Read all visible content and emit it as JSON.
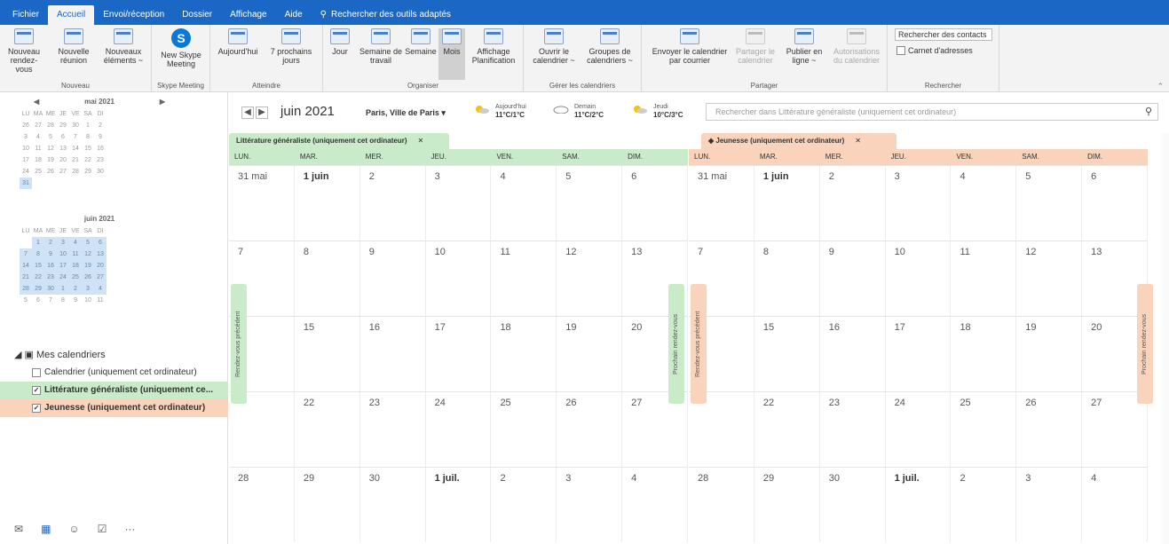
{
  "tabs": [
    "Fichier",
    "Accueil",
    "Envoi/réception",
    "Dossier",
    "Affichage",
    "Aide",
    "Rechercher des outils adaptés"
  ],
  "active_tab": "Accueil",
  "ribbon": {
    "nouveau": {
      "label": "Nouveau",
      "btn1": "Nouveau rendez-vous",
      "btn2": "Nouvelle réunion",
      "btn3": "Nouveaux éléments ~"
    },
    "skype": {
      "label": "Skype Meeting",
      "btn": "New Skype Meeting"
    },
    "atteindre": {
      "label": "Atteindre",
      "btn1": "Aujourd'hui",
      "btn2": "7 prochains jours"
    },
    "organiser": {
      "label": "Organiser",
      "jour": "Jour",
      "semaine_travail": "Semaine de travail",
      "semaine": "Semaine",
      "mois": "Mois",
      "planif": "Affichage Planification"
    },
    "gerer": {
      "label": "Gérer les calendriers",
      "btn1": "Ouvrir le calendrier ~",
      "btn2": "Groupes de calendriers ~"
    },
    "partager": {
      "label": "Partager",
      "btn1": "Envoyer le calendrier par courrier",
      "btn2": "Partager le calendrier",
      "btn3": "Publier en ligne ~",
      "btn4": "Autorisations du calendrier"
    },
    "rechercher": {
      "label": "Rechercher",
      "search_contacts": "Rechercher des contacts",
      "carnet": "Carnet d'adresses"
    }
  },
  "mini_may": {
    "title": "mai 2021",
    "days": [
      "LU",
      "MA",
      "ME",
      "JE",
      "VE",
      "SA",
      "DI"
    ],
    "rows": [
      [
        "26",
        "27",
        "28",
        "29",
        "30",
        "1",
        "2"
      ],
      [
        "3",
        "4",
        "5",
        "6",
        "7",
        "8",
        "9"
      ],
      [
        "10",
        "11",
        "12",
        "13",
        "14",
        "15",
        "16"
      ],
      [
        "17",
        "18",
        "19",
        "20",
        "21",
        "22",
        "23"
      ],
      [
        "24",
        "25",
        "26",
        "27",
        "28",
        "29",
        "30"
      ],
      [
        "31",
        "",
        "",
        "",
        "",
        "",
        ""
      ]
    ]
  },
  "mini_june": {
    "title": "juin 2021",
    "days": [
      "LU",
      "MA",
      "ME",
      "JE",
      "VE",
      "SA",
      "DI"
    ],
    "rows": [
      [
        "",
        "1",
        "2",
        "3",
        "4",
        "5",
        "6"
      ],
      [
        "7",
        "8",
        "9",
        "10",
        "11",
        "12",
        "13"
      ],
      [
        "14",
        "15",
        "16",
        "17",
        "18",
        "19",
        "20"
      ],
      [
        "21",
        "22",
        "23",
        "24",
        "25",
        "26",
        "27"
      ],
      [
        "28",
        "29",
        "30",
        "1",
        "2",
        "3",
        "4"
      ],
      [
        "5",
        "6",
        "7",
        "8",
        "9",
        "10",
        "11"
      ]
    ]
  },
  "calendars": {
    "header": "Mes calendriers",
    "items": [
      "Calendrier (uniquement cet ordinateur)",
      "Littérature généraliste (uniquement ce...",
      "Jeunesse (uniquement cet ordinateur)"
    ]
  },
  "bottom_nav": [
    "mail-icon",
    "calendar-icon",
    "people-icon",
    "tasks-icon",
    "more-icon"
  ],
  "header": {
    "month": "juin 2021",
    "location": "Paris, Ville de Paris",
    "weather": [
      {
        "day": "Aujourd'hui",
        "temp": "11°C/1°C"
      },
      {
        "day": "Demain",
        "temp": "11°C/2°C"
      },
      {
        "day": "Jeudi",
        "temp": "10°C/3°C"
      }
    ],
    "search_placeholder": "Rechercher dans Littérature généraliste (uniquement cet ordinateur)"
  },
  "panes": [
    {
      "title": "Littérature généraliste (uniquement cet ordinateur)",
      "color": "#c9ebc9",
      "side_left": "Rendez-vous précédent",
      "side_right": "Prochain rendez-vous",
      "weekdays": [
        "LUN.",
        "MAR.",
        "MER.",
        "JEU.",
        "VEN.",
        "SAM.",
        "DIM."
      ],
      "weeks": [
        [
          "31 mai",
          "1 juin",
          "2",
          "3",
          "4",
          "5",
          "6"
        ],
        [
          "7",
          "8",
          "9",
          "10",
          "11",
          "12",
          "13"
        ],
        [
          "",
          "15",
          "16",
          "17",
          "18",
          "19",
          "20"
        ],
        [
          "",
          "22",
          "23",
          "24",
          "25",
          "26",
          "27"
        ],
        [
          "28",
          "29",
          "30",
          "1 juil.",
          "2",
          "3",
          "4"
        ]
      ]
    },
    {
      "title": "Jeunesse (uniquement cet ordinateur)",
      "color": "#f9d3bc",
      "side_left": "Rendez-vous précédent",
      "side_right": "Prochain rendez-vous",
      "weekdays": [
        "LUN.",
        "MAR.",
        "MER.",
        "JEU.",
        "VEN.",
        "SAM.",
        "DIM."
      ],
      "weeks": [
        [
          "31 mai",
          "1 juin",
          "2",
          "3",
          "4",
          "5",
          "6"
        ],
        [
          "7",
          "8",
          "9",
          "10",
          "11",
          "12",
          "13"
        ],
        [
          "",
          "15",
          "16",
          "17",
          "18",
          "19",
          "20"
        ],
        [
          "",
          "22",
          "23",
          "24",
          "25",
          "26",
          "27"
        ],
        [
          "28",
          "29",
          "30",
          "1 juil.",
          "2",
          "3",
          "4"
        ]
      ]
    }
  ]
}
